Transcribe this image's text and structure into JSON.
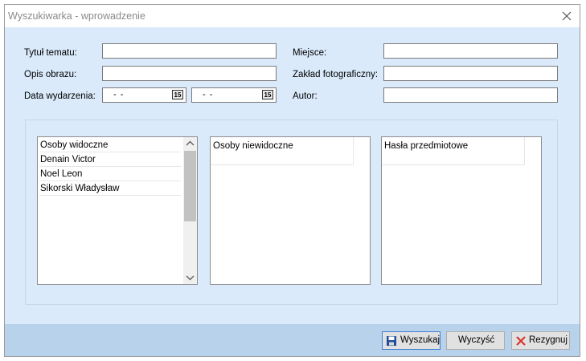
{
  "window": {
    "title": "Wyszukiwarka - wprowadzenie"
  },
  "form": {
    "tytul_label": "Tytuł tematu:",
    "opis_label": "Opis obrazu:",
    "data_label": "Data wydarzenia:",
    "date_from": "- -",
    "date_to": "- -",
    "calendar_icon_text": "15",
    "miejsce_label": "Miejsce:",
    "zaklad_label": "Zakład fotograficzny:",
    "autor_label": "Autor:"
  },
  "lists": {
    "visible_header": "Osoby widoczne",
    "visible_items": [
      "Denain Victor",
      "Noel Leon",
      "Sikorski Władysław"
    ],
    "invisible_header": "Osoby niewidoczne",
    "keywords_header": "Hasła przedmiotowe"
  },
  "buttons": {
    "search": "Wyszukaj",
    "clear": "Wyczyść",
    "cancel": "Rezygnuj"
  },
  "colors": {
    "window_bg": "#daeafb",
    "bottom_bar": "#b9d2ec",
    "cancel_icon": "#d9352b",
    "save_icon": "#1f4e9c"
  }
}
